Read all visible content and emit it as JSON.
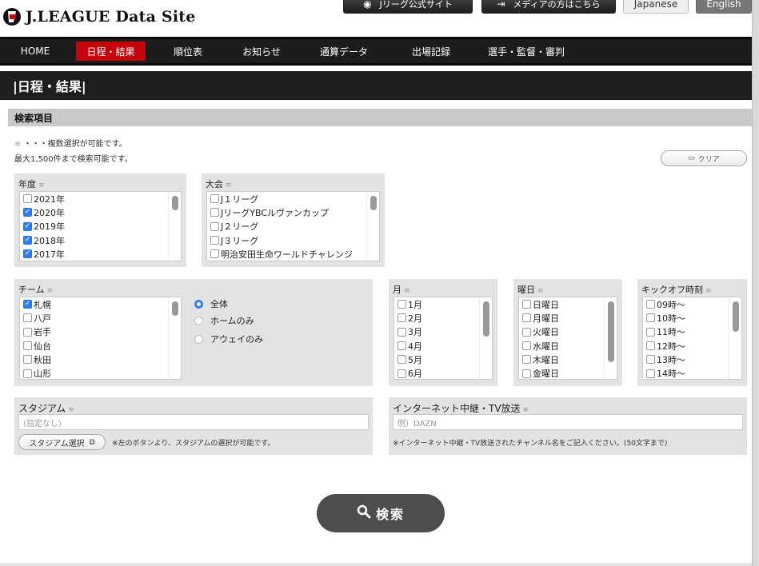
{
  "header": {
    "site_title": "J.LEAGUE Data Site",
    "official_site": "Jリーグ公式サイト",
    "media": "メディアの方はこちら",
    "lang_ja": "Japanese",
    "lang_en": "English"
  },
  "nav": {
    "items": [
      "HOME",
      "日程・結果",
      "順位表",
      "お知らせ",
      "通算データ",
      "出場記録",
      "選手・監督・審判"
    ],
    "active": "日程・結果"
  },
  "page_title": "|日程・結果|",
  "search": {
    "section_title": "検索項目",
    "note_multi": "・・・複数選択が可能です。",
    "note_max": "最大1,500件まで検索可能です。",
    "clear": "クリア",
    "year": {
      "label": "年度",
      "items": [
        {
          "label": "2021年",
          "checked": false
        },
        {
          "label": "2020年",
          "checked": true
        },
        {
          "label": "2019年",
          "checked": true
        },
        {
          "label": "2018年",
          "checked": true
        },
        {
          "label": "2017年",
          "checked": true
        }
      ]
    },
    "competition": {
      "label": "大会",
      "items": [
        {
          "label": "J１リーグ",
          "checked": false
        },
        {
          "label": "JリーグYBCルヴァンカップ",
          "checked": false
        },
        {
          "label": "J２リーグ",
          "checked": false
        },
        {
          "label": "J３リーグ",
          "checked": false
        },
        {
          "label": "明治安田生命ワールドチャレンジ",
          "checked": false
        }
      ]
    },
    "team": {
      "label": "チーム",
      "items": [
        {
          "label": "札幌",
          "checked": true
        },
        {
          "label": "八戸",
          "checked": false
        },
        {
          "label": "岩手",
          "checked": false
        },
        {
          "label": "仙台",
          "checked": false
        },
        {
          "label": "秋田",
          "checked": false
        },
        {
          "label": "山形",
          "checked": false
        }
      ],
      "radios": [
        {
          "label": "全体",
          "checked": true
        },
        {
          "label": "ホームのみ",
          "checked": false
        },
        {
          "label": "アウェイのみ",
          "checked": false
        }
      ]
    },
    "month": {
      "label": "月",
      "items": [
        {
          "label": "1月",
          "checked": false
        },
        {
          "label": "2月",
          "checked": false
        },
        {
          "label": "3月",
          "checked": false
        },
        {
          "label": "4月",
          "checked": false
        },
        {
          "label": "5月",
          "checked": false
        },
        {
          "label": "6月",
          "checked": false
        }
      ]
    },
    "weekday": {
      "label": "曜日",
      "items": [
        {
          "label": "日曜日",
          "checked": false
        },
        {
          "label": "月曜日",
          "checked": false
        },
        {
          "label": "火曜日",
          "checked": false
        },
        {
          "label": "水曜日",
          "checked": false
        },
        {
          "label": "木曜日",
          "checked": false
        },
        {
          "label": "金曜日",
          "checked": false
        }
      ]
    },
    "kickoff": {
      "label": "キックオフ時刻",
      "items": [
        {
          "label": "09時～",
          "checked": false
        },
        {
          "label": "10時～",
          "checked": false
        },
        {
          "label": "11時～",
          "checked": false
        },
        {
          "label": "12時～",
          "checked": false
        },
        {
          "label": "13時～",
          "checked": false
        },
        {
          "label": "14時～",
          "checked": false
        }
      ]
    },
    "stadium": {
      "label": "スタジアム",
      "value": "(指定なし)",
      "button": "スタジアム選択",
      "note": "※左のボタンより、スタジアムの選択が可能です。"
    },
    "broadcast": {
      "label": "インターネット中継・TV放送",
      "placeholder": "例）DAZN",
      "note": "※インターネット中継・TV放送されたチャンネル名をご記入ください。(50文字まで)"
    },
    "submit": "検索"
  },
  "colors": {
    "accent": "#c7000b",
    "checkbox": "#2d7ff9",
    "nav_bg": "#1c1c1c",
    "panel_bg": "#e3e3e3"
  }
}
